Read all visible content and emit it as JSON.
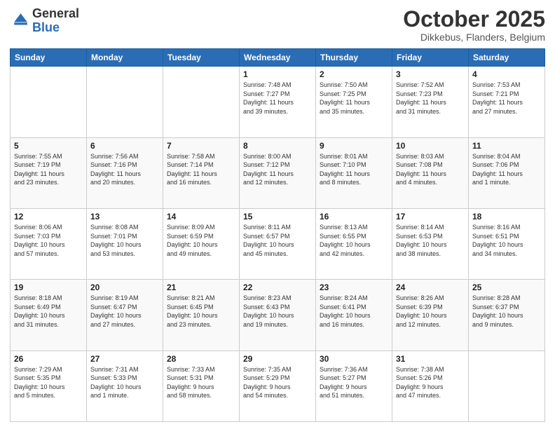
{
  "logo": {
    "general": "General",
    "blue": "Blue"
  },
  "header": {
    "month": "October 2025",
    "location": "Dikkebus, Flanders, Belgium"
  },
  "weekdays": [
    "Sunday",
    "Monday",
    "Tuesday",
    "Wednesday",
    "Thursday",
    "Friday",
    "Saturday"
  ],
  "weeks": [
    [
      {
        "day": "",
        "info": ""
      },
      {
        "day": "",
        "info": ""
      },
      {
        "day": "",
        "info": ""
      },
      {
        "day": "1",
        "info": "Sunrise: 7:48 AM\nSunset: 7:27 PM\nDaylight: 11 hours\nand 39 minutes."
      },
      {
        "day": "2",
        "info": "Sunrise: 7:50 AM\nSunset: 7:25 PM\nDaylight: 11 hours\nand 35 minutes."
      },
      {
        "day": "3",
        "info": "Sunrise: 7:52 AM\nSunset: 7:23 PM\nDaylight: 11 hours\nand 31 minutes."
      },
      {
        "day": "4",
        "info": "Sunrise: 7:53 AM\nSunset: 7:21 PM\nDaylight: 11 hours\nand 27 minutes."
      }
    ],
    [
      {
        "day": "5",
        "info": "Sunrise: 7:55 AM\nSunset: 7:19 PM\nDaylight: 11 hours\nand 23 minutes."
      },
      {
        "day": "6",
        "info": "Sunrise: 7:56 AM\nSunset: 7:16 PM\nDaylight: 11 hours\nand 20 minutes."
      },
      {
        "day": "7",
        "info": "Sunrise: 7:58 AM\nSunset: 7:14 PM\nDaylight: 11 hours\nand 16 minutes."
      },
      {
        "day": "8",
        "info": "Sunrise: 8:00 AM\nSunset: 7:12 PM\nDaylight: 11 hours\nand 12 minutes."
      },
      {
        "day": "9",
        "info": "Sunrise: 8:01 AM\nSunset: 7:10 PM\nDaylight: 11 hours\nand 8 minutes."
      },
      {
        "day": "10",
        "info": "Sunrise: 8:03 AM\nSunset: 7:08 PM\nDaylight: 11 hours\nand 4 minutes."
      },
      {
        "day": "11",
        "info": "Sunrise: 8:04 AM\nSunset: 7:06 PM\nDaylight: 11 hours\nand 1 minute."
      }
    ],
    [
      {
        "day": "12",
        "info": "Sunrise: 8:06 AM\nSunset: 7:03 PM\nDaylight: 10 hours\nand 57 minutes."
      },
      {
        "day": "13",
        "info": "Sunrise: 8:08 AM\nSunset: 7:01 PM\nDaylight: 10 hours\nand 53 minutes."
      },
      {
        "day": "14",
        "info": "Sunrise: 8:09 AM\nSunset: 6:59 PM\nDaylight: 10 hours\nand 49 minutes."
      },
      {
        "day": "15",
        "info": "Sunrise: 8:11 AM\nSunset: 6:57 PM\nDaylight: 10 hours\nand 45 minutes."
      },
      {
        "day": "16",
        "info": "Sunrise: 8:13 AM\nSunset: 6:55 PM\nDaylight: 10 hours\nand 42 minutes."
      },
      {
        "day": "17",
        "info": "Sunrise: 8:14 AM\nSunset: 6:53 PM\nDaylight: 10 hours\nand 38 minutes."
      },
      {
        "day": "18",
        "info": "Sunrise: 8:16 AM\nSunset: 6:51 PM\nDaylight: 10 hours\nand 34 minutes."
      }
    ],
    [
      {
        "day": "19",
        "info": "Sunrise: 8:18 AM\nSunset: 6:49 PM\nDaylight: 10 hours\nand 31 minutes."
      },
      {
        "day": "20",
        "info": "Sunrise: 8:19 AM\nSunset: 6:47 PM\nDaylight: 10 hours\nand 27 minutes."
      },
      {
        "day": "21",
        "info": "Sunrise: 8:21 AM\nSunset: 6:45 PM\nDaylight: 10 hours\nand 23 minutes."
      },
      {
        "day": "22",
        "info": "Sunrise: 8:23 AM\nSunset: 6:43 PM\nDaylight: 10 hours\nand 19 minutes."
      },
      {
        "day": "23",
        "info": "Sunrise: 8:24 AM\nSunset: 6:41 PM\nDaylight: 10 hours\nand 16 minutes."
      },
      {
        "day": "24",
        "info": "Sunrise: 8:26 AM\nSunset: 6:39 PM\nDaylight: 10 hours\nand 12 minutes."
      },
      {
        "day": "25",
        "info": "Sunrise: 8:28 AM\nSunset: 6:37 PM\nDaylight: 10 hours\nand 9 minutes."
      }
    ],
    [
      {
        "day": "26",
        "info": "Sunrise: 7:29 AM\nSunset: 5:35 PM\nDaylight: 10 hours\nand 5 minutes."
      },
      {
        "day": "27",
        "info": "Sunrise: 7:31 AM\nSunset: 5:33 PM\nDaylight: 10 hours\nand 1 minute."
      },
      {
        "day": "28",
        "info": "Sunrise: 7:33 AM\nSunset: 5:31 PM\nDaylight: 9 hours\nand 58 minutes."
      },
      {
        "day": "29",
        "info": "Sunrise: 7:35 AM\nSunset: 5:29 PM\nDaylight: 9 hours\nand 54 minutes."
      },
      {
        "day": "30",
        "info": "Sunrise: 7:36 AM\nSunset: 5:27 PM\nDaylight: 9 hours\nand 51 minutes."
      },
      {
        "day": "31",
        "info": "Sunrise: 7:38 AM\nSunset: 5:26 PM\nDaylight: 9 hours\nand 47 minutes."
      },
      {
        "day": "",
        "info": ""
      }
    ]
  ]
}
